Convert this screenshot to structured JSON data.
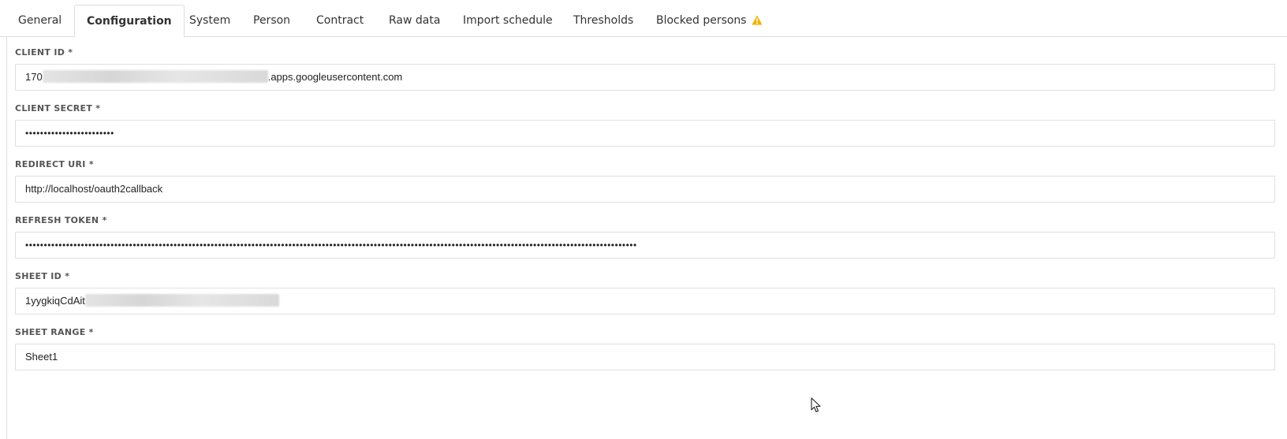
{
  "tabs": [
    {
      "label": "General"
    },
    {
      "label": "Configuration"
    },
    {
      "label": "System"
    },
    {
      "label": "Person"
    },
    {
      "label": "Contract"
    },
    {
      "label": "Raw data"
    },
    {
      "label": "Import schedule"
    },
    {
      "label": "Thresholds"
    },
    {
      "label": "Blocked persons"
    }
  ],
  "active_tab": "Configuration",
  "blocked_warning_icon": "warning-icon",
  "warning_color": "#f0b400",
  "fields": {
    "client_id": {
      "label": "CLIENT ID *",
      "value_prefix": "170",
      "value_suffix": ".apps.googleusercontent.com"
    },
    "client_secret": {
      "label": "CLIENT SECRET *",
      "value": "••••••••••••••••••••••••"
    },
    "redirect_uri": {
      "label": "REDIRECT URI *",
      "value": "http://localhost/oauth2callback"
    },
    "refresh_token": {
      "label": "REFRESH TOKEN *",
      "value": "•••••••••••••••••••••••••••••••••••••••••••••••••••••••••••••••••••••••••••••••••••••••••••••••••••••••••••••••••••••••••••••••••••••••••••••••••••••••••••••••••••••"
    },
    "sheet_id": {
      "label": "SHEET ID *",
      "value_prefix": "1yygkiqCdAit"
    },
    "sheet_range": {
      "label": "SHEET RANGE *",
      "value": "Sheet1"
    }
  }
}
